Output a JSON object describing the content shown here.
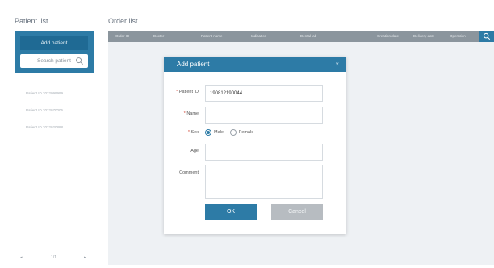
{
  "left": {
    "title": "Patient list",
    "add_button": "Add patient",
    "search_placeholder": "Search patient",
    "patients": [
      "Patient ID 2022099999",
      "Patient ID 2022070006",
      "Patient ID 2022020888"
    ],
    "pager": {
      "prev": "◂",
      "page": "1/1",
      "next": "▸"
    }
  },
  "right": {
    "title": "Order list",
    "columns": [
      "Order ID",
      "Doctor",
      "Patient name",
      "Indication",
      "Dental lab",
      "Creation date",
      "Delivery date",
      "Operation"
    ]
  },
  "modal": {
    "title": "Add patient",
    "close": "×",
    "fields": {
      "patient_id": {
        "label": "Patient ID",
        "required": "*",
        "value": "190812190044"
      },
      "name": {
        "label": "Name",
        "required": "*",
        "value": ""
      },
      "sex": {
        "label": "Sex",
        "required": "*",
        "options": [
          "Male",
          "Female"
        ],
        "selected": "Male"
      },
      "age": {
        "label": "Age",
        "value": ""
      },
      "comment": {
        "label": "Comment",
        "value": ""
      }
    },
    "ok": "OK",
    "cancel": "Cancel"
  },
  "colors": {
    "accent": "#2d7ba6",
    "table_header": "#8b959d",
    "panel_bg": "#eef1f4",
    "cancel_bg": "#b7bcc1",
    "required": "#d24a3a"
  }
}
